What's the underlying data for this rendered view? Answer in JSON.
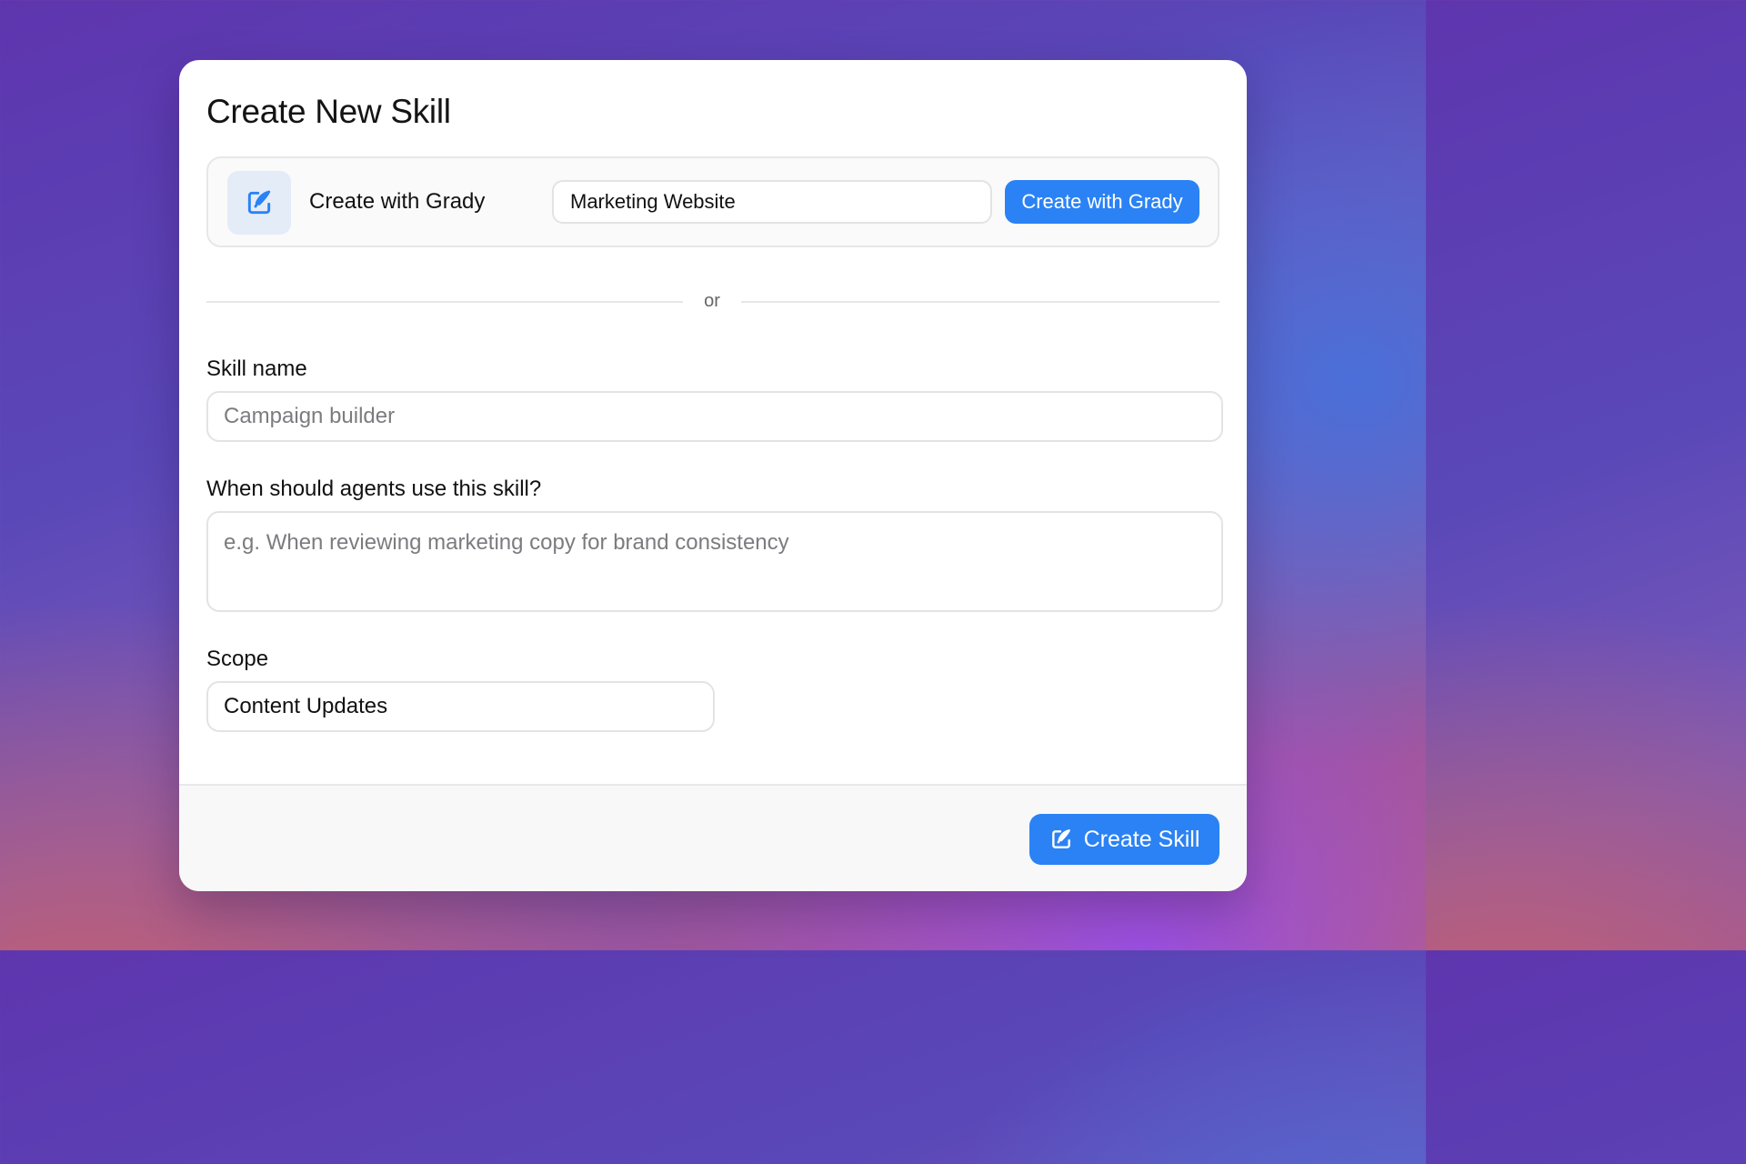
{
  "dialog": {
    "title": "Create New Skill"
  },
  "grady": {
    "icon": "edit-pen-icon",
    "label": "Create with Grady",
    "input_value": "Marketing Website",
    "button_label": "Create with Grady"
  },
  "divider": {
    "text": "or"
  },
  "form": {
    "skill_name": {
      "label": "Skill name",
      "value": "",
      "placeholder": "Campaign builder"
    },
    "when_to_use": {
      "label": "When should agents use this skill?",
      "value": "",
      "placeholder": "e.g. When reviewing marketing copy for brand consistency"
    },
    "scope": {
      "label": "Scope",
      "value": "Content Updates"
    }
  },
  "footer": {
    "create_button_label": "Create Skill",
    "create_button_icon": "edit-pen-icon"
  },
  "colors": {
    "accent": "#2b82f4",
    "icon_bg": "#e4ecf8"
  }
}
